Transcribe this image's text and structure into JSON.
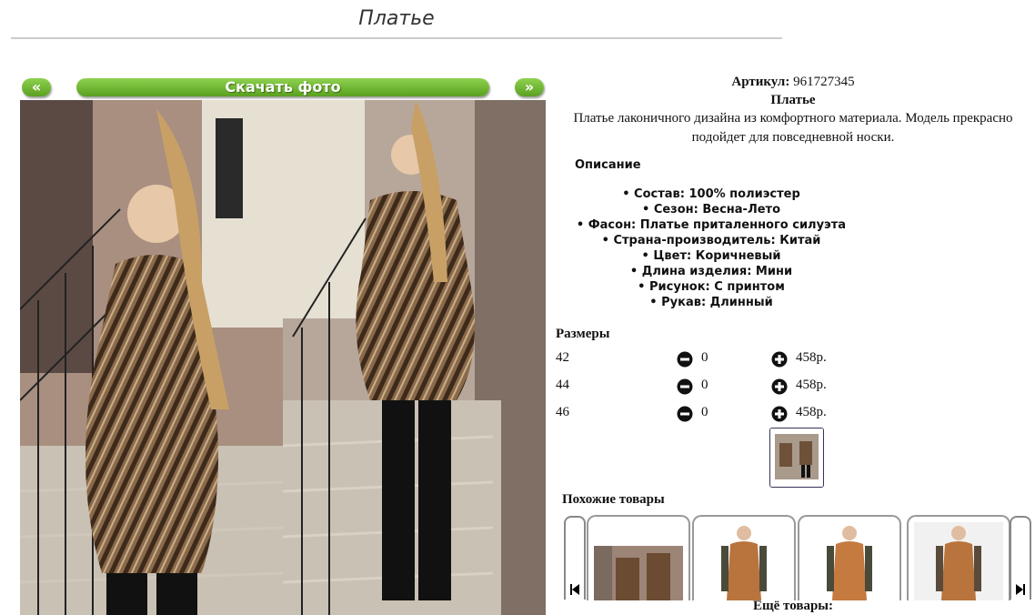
{
  "page": {
    "title": "Платье"
  },
  "gallery": {
    "prev_label": "«",
    "next_label": "»",
    "download_label": "Скачать фото"
  },
  "product": {
    "article_label": "Артикул:",
    "article_value": "961727345",
    "name": "Платье",
    "description_line1": "Платье лаконичного дизайна из комфортного материала. Модель прекрасно",
    "description_line2": "подойдет для повседневной носки."
  },
  "description": {
    "heading": "Описание",
    "properties": [
      "Состав: 100% полиэстер",
      "Сезон: Весна-Лето",
      "Фасон: Платье приталенного силуэта",
      "Страна-производитель: Китай",
      "Цвет: Коричневый",
      "Длина изделия: Мини",
      "Рисунок: С принтом",
      "Рукав: Длинный"
    ]
  },
  "sizes": {
    "heading": "Размеры",
    "rows": [
      {
        "size": "42",
        "qty": "0",
        "price": "458р."
      },
      {
        "size": "44",
        "qty": "0",
        "price": "458р."
      },
      {
        "size": "46",
        "qty": "0",
        "price": "458р."
      }
    ]
  },
  "similar": {
    "heading": "Похожие товары",
    "more_label": "Ещё товары:"
  },
  "icons": {
    "minus": "minus-circle-icon",
    "plus": "plus-circle-icon",
    "prev": "skip-back-icon",
    "next": "skip-forward-icon"
  }
}
